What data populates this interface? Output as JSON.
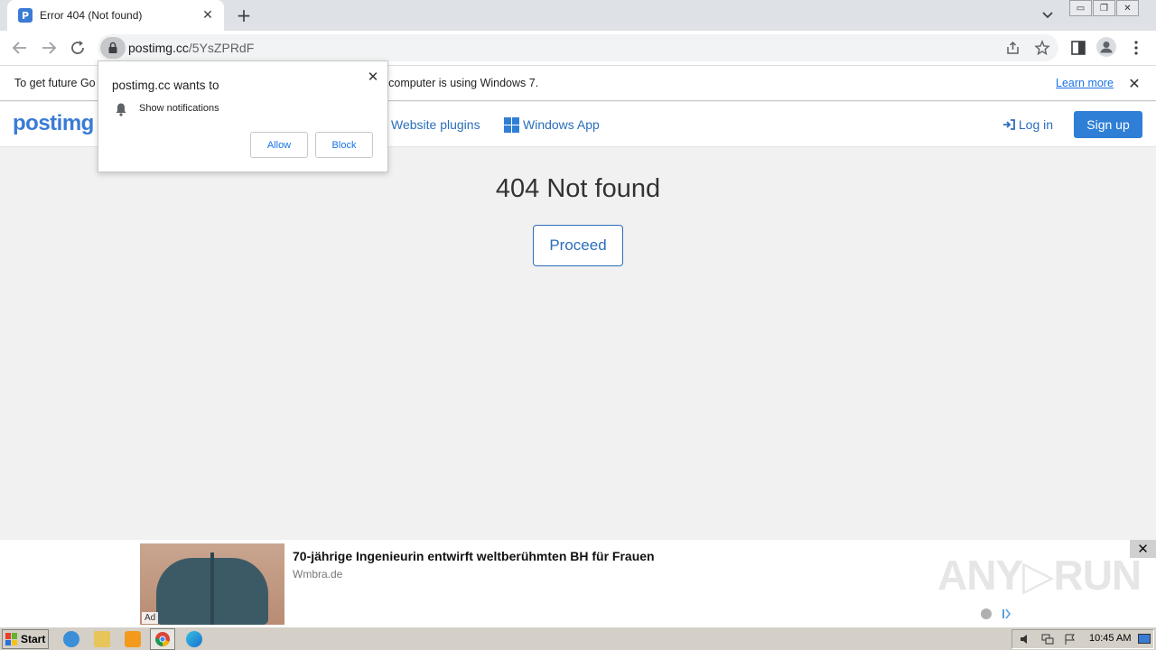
{
  "browser": {
    "tab_title": "Error 404 (Not found)",
    "favicon_letter": "P",
    "url_host": "postimg.cc",
    "url_path": "/5YsZPRdF",
    "new_tab_label": "+",
    "close_tab_label": "✕"
  },
  "infobar": {
    "text": "To get future Go",
    "text_tail": "is computer is using Windows 7.",
    "learn_more": "Learn more",
    "close_label": "✕"
  },
  "permission": {
    "title": "postimg.cc wants to",
    "item": "Show notifications",
    "allow": "Allow",
    "block": "Block",
    "close_label": "✕"
  },
  "site": {
    "logo": "postimg",
    "nav": {
      "website_plugins": "Website plugins",
      "windows_app": "Windows App"
    },
    "login": "Log in",
    "signup": "Sign up"
  },
  "main": {
    "heading": "404 Not found",
    "proceed": "Proceed"
  },
  "ad": {
    "headline": "70-jährige Ingenieurin entwirft weltberühmten BH für Frauen",
    "source": "Wmbra.de",
    "label": "Ad",
    "close_label": "✕",
    "watermark": "ANY▷RUN"
  },
  "taskbar": {
    "start": "Start",
    "clock": "10:45 AM"
  },
  "colors": {
    "brand_blue": "#2f7fd6",
    "link_blue": "#2a6ebb",
    "page_bg": "#f1f1f1"
  }
}
